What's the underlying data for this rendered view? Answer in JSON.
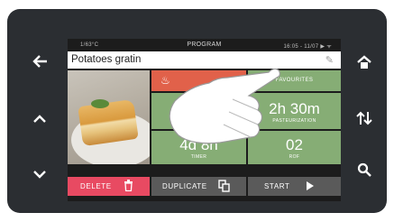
{
  "status_bar": {
    "left": "1/63°C",
    "title": "PROGRAM",
    "right": "16:05 - 11/07  ▶ ᯤ"
  },
  "program": {
    "name": "Potatoes gratin"
  },
  "tiles": {
    "favourites": "FAVOURITES",
    "pasteurization_value": "2h 30m",
    "pasteurization_label": "PASTEURIZATION",
    "timer_value": "4d 8h",
    "timer_label": "TIMER",
    "rof_value": "02",
    "rof_label": "ROF"
  },
  "actions": {
    "delete": "DELETE",
    "duplicate": "DUPLICATE",
    "start": "START"
  },
  "colors": {
    "green_tile": "#86ad75",
    "orange_tile": "#e1614a",
    "delete_button": "#e84a62",
    "gray_button": "#5a5a5a",
    "frame": "#2b2e32"
  }
}
